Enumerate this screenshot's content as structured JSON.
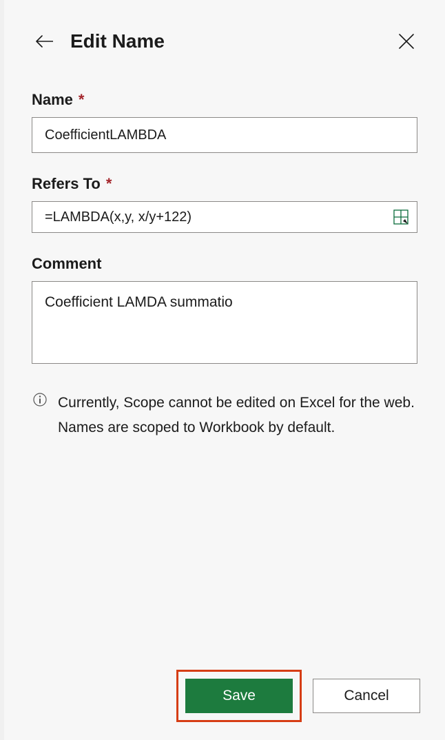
{
  "header": {
    "title": "Edit Name"
  },
  "fields": {
    "name": {
      "label": "Name",
      "value": "CoefficientLAMBDA"
    },
    "refersTo": {
      "label": "Refers To",
      "value": "=LAMBDA(x,y, x/y+122)"
    },
    "comment": {
      "label": "Comment",
      "value": "Coefficient LAMDA summatio"
    }
  },
  "info": {
    "text": "Currently, Scope cannot be edited on Excel for the web. Names are scoped to Workbook by default."
  },
  "footer": {
    "save": "Save",
    "cancel": "Cancel"
  }
}
